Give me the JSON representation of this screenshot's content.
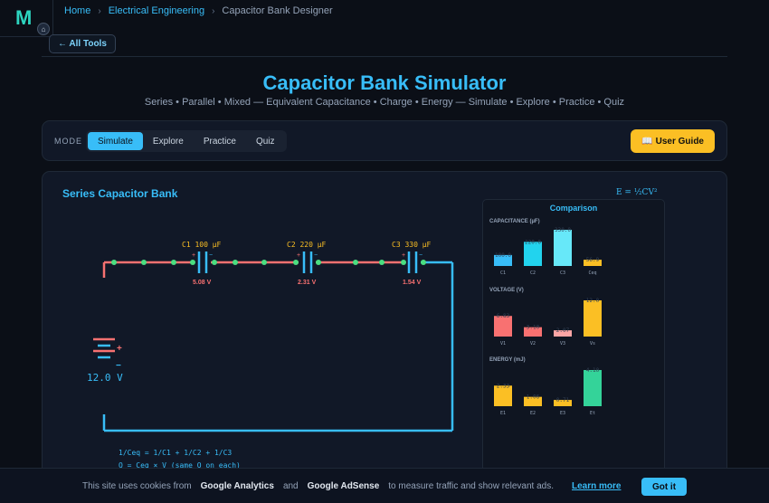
{
  "logo": {
    "letter": "M",
    "badge_icon": "home-icon"
  },
  "breadcrumb": {
    "home": "Home",
    "category": "Electrical Engineering",
    "current": "Capacitor Bank Designer"
  },
  "all_tools_label": "← All Tools",
  "title": "Capacitor Bank Simulator",
  "subtitle": "Series • Parallel • Mixed — Equivalent Capacitance • Charge • Energy — Simulate • Explore • Practice • Quiz",
  "mode": {
    "label": "MODE",
    "tabs": [
      "Simulate",
      "Explore",
      "Practice",
      "Quiz"
    ],
    "active": "Simulate"
  },
  "guide_label": "📖 User Guide",
  "panel": {
    "title": "Series Capacitor Bank",
    "energy_formula": "E = ½CV²"
  },
  "circuit": {
    "capacitors": [
      {
        "label": "C1  100 µF",
        "voltage": "5.08 V"
      },
      {
        "label": "C2  220 µF",
        "voltage": "2.31 V"
      },
      {
        "label": "C3  330 µF",
        "voltage": "1.54 V"
      }
    ],
    "battery_voltage": "12.0 V",
    "plus_sign": "+",
    "minus_sign": "−"
  },
  "formulas": [
    "1/Ceq = 1/C1 + 1/C2 + 1/C3",
    "Q = Ceq × V (same Q on each)"
  ],
  "comparison": {
    "title": "Comparison",
    "sections": [
      {
        "label": "CAPACITANCE (µF)",
        "bars": [
          {
            "name": "C1",
            "value": 100,
            "value_label": "100.0",
            "color": "#38bdf8"
          },
          {
            "name": "C2",
            "value": 220,
            "value_label": "220.0",
            "color": "#22d3ee"
          },
          {
            "name": "C3",
            "value": 330,
            "value_label": "330.0",
            "color": "#67e8f9"
          },
          {
            "name": "Ceq",
            "value": 56.9,
            "value_label": "56.9",
            "color": "#fbbf24"
          }
        ]
      },
      {
        "label": "VOLTAGE (V)",
        "bars": [
          {
            "name": "V1",
            "value": 6.83,
            "value_label": "6.83",
            "color": "#f87171"
          },
          {
            "name": "V2",
            "value": 3.1,
            "value_label": "3.10",
            "color": "#f87171"
          },
          {
            "name": "V3",
            "value": 2.07,
            "value_label": "2.07",
            "color": "#fca5a5"
          },
          {
            "name": "Vs",
            "value": 12.0,
            "value_label": "12.0",
            "color": "#fbbf24"
          }
        ]
      },
      {
        "label": "ENERGY (mJ)",
        "bars": [
          {
            "name": "E1",
            "value": 2.33,
            "value_label": "2.33",
            "color": "#fbbf24"
          },
          {
            "name": "E2",
            "value": 1.06,
            "value_label": "1.06",
            "color": "#fbbf24"
          },
          {
            "name": "E3",
            "value": 0.71,
            "value_label": "0.71",
            "color": "#fbbf24"
          },
          {
            "name": "Et",
            "value": 4.1,
            "value_label": "4.10",
            "color": "#34d399"
          }
        ]
      }
    ]
  },
  "cookie": {
    "text1": "This site uses cookies from",
    "ga": "Google Analytics",
    "and": "and",
    "ads": "Google AdSense",
    "text2": "to measure traffic and show relevant ads.",
    "learn_more": "Learn more",
    "button": "Got it"
  }
}
